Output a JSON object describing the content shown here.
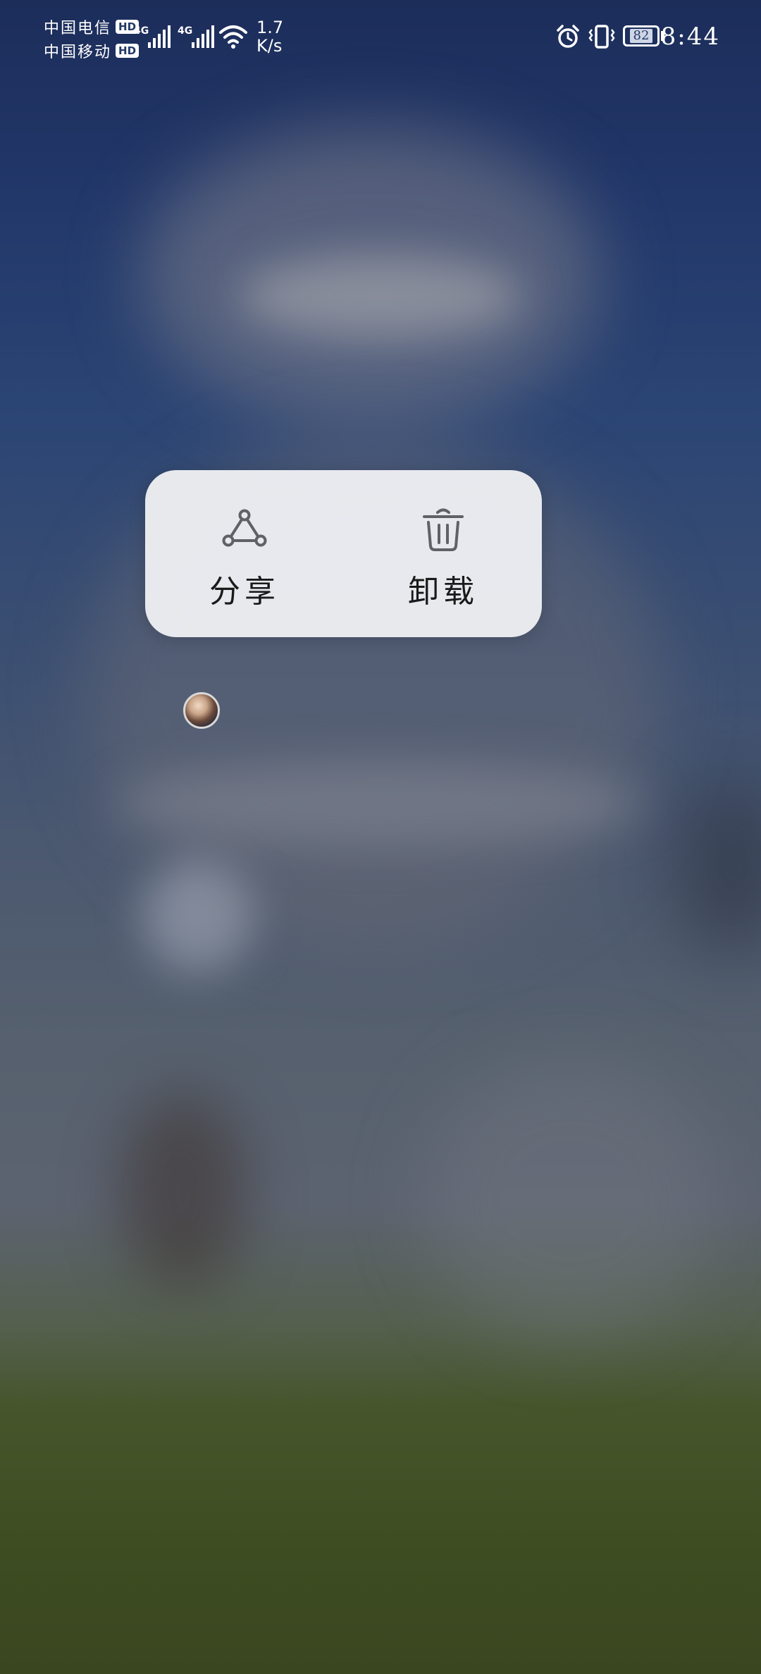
{
  "status_bar": {
    "carrier_1": "中国电信",
    "carrier_2": "中国移动",
    "hd_label": "HD",
    "network_type_1": "4G",
    "network_type_2": "4G",
    "speed_value": "1.7",
    "speed_unit": "K/s",
    "battery_level": "82",
    "time": "8:44",
    "icons": [
      "signal-icon",
      "wifi-icon",
      "alarm-icon",
      "vibrate-icon",
      "battery-icon"
    ]
  },
  "context_menu": {
    "items": [
      {
        "label": "分享",
        "icon": "share-icon"
      },
      {
        "label": "卸载",
        "icon": "trash-icon"
      }
    ]
  },
  "app_icon": {
    "icon": "app-avatar-icon"
  },
  "colors": {
    "menu_background": "#eeeff2",
    "icon_stroke": "#5f6166",
    "label_text": "#1a1a1a",
    "wallpaper_top": "#1c2d5a",
    "wallpaper_bottom": "#3a4620"
  }
}
